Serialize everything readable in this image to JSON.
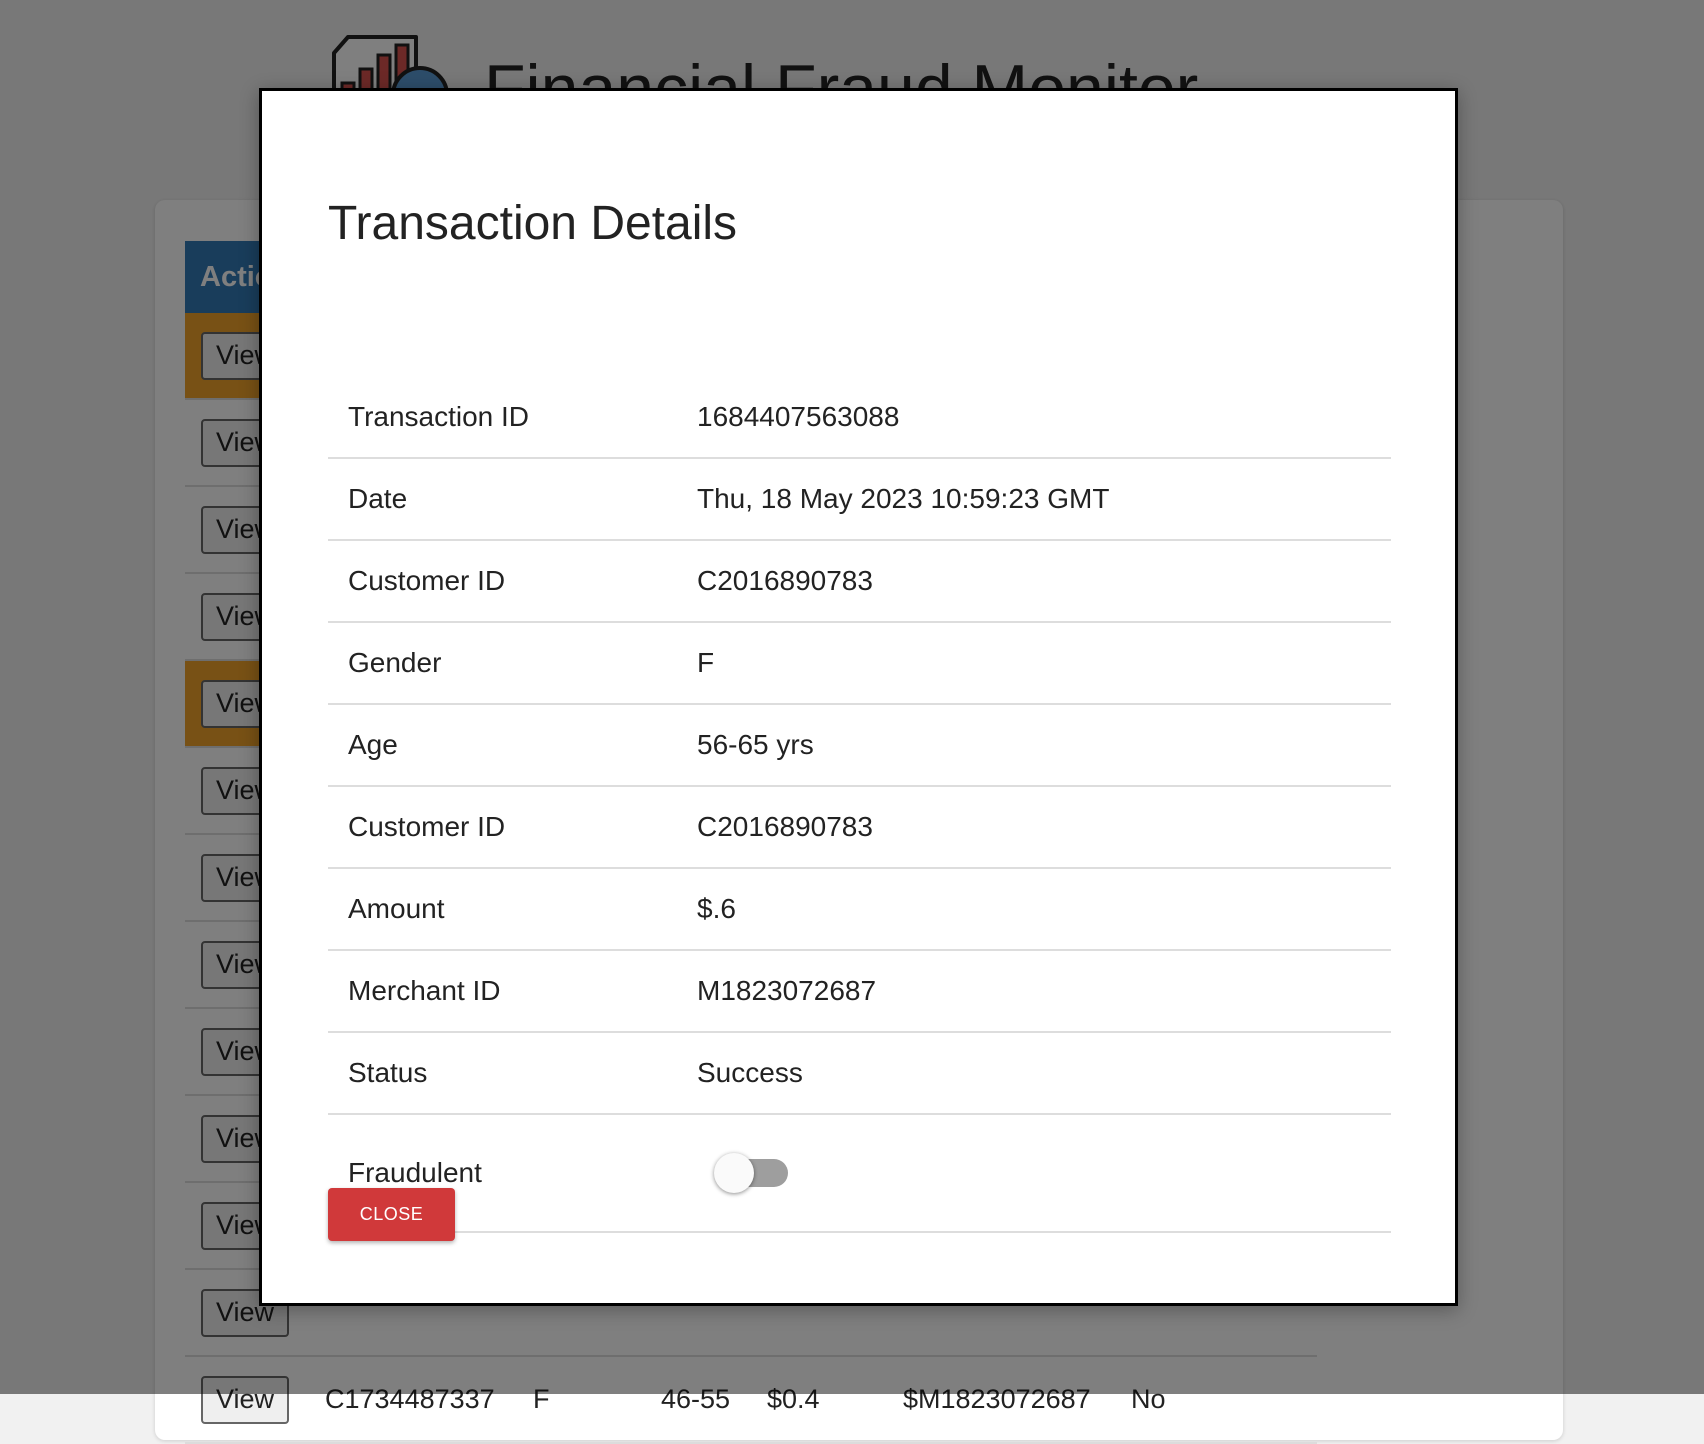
{
  "app": {
    "title": "Financial Fraud Monitor",
    "logo_icon": "chart-analytics-icon"
  },
  "table": {
    "action_header": "Actions",
    "view_label": "View",
    "rows": [
      {
        "flagged": true
      },
      {
        "flagged": false
      },
      {
        "flagged": false
      },
      {
        "flagged": false
      },
      {
        "flagged": true
      },
      {
        "flagged": false
      },
      {
        "flagged": false
      },
      {
        "flagged": false
      },
      {
        "flagged": false
      },
      {
        "flagged": false
      },
      {
        "flagged": false
      },
      {
        "flagged": false
      },
      {
        "flagged": false,
        "customer_id": "C1734487337",
        "gender": "F",
        "age": "46-55",
        "amount": "$0.4",
        "merchant": "$M1823072687",
        "fraud": "No"
      }
    ]
  },
  "modal": {
    "title": "Transaction Details",
    "fields": [
      {
        "label": "Transaction ID",
        "value": "1684407563088"
      },
      {
        "label": "Date",
        "value": "Thu, 18 May 2023 10:59:23 GMT"
      },
      {
        "label": "Customer ID",
        "value": "C2016890783"
      },
      {
        "label": "Gender",
        "value": "F"
      },
      {
        "label": "Age",
        "value": "56-65 yrs"
      },
      {
        "label": "Customer ID",
        "value": "C2016890783"
      },
      {
        "label": "Amount",
        "value": "$.6"
      },
      {
        "label": "Merchant ID",
        "value": "M1823072687"
      },
      {
        "label": "Status",
        "value": "Success"
      }
    ],
    "fraudulent": {
      "label": "Fraudulent",
      "checked": false
    },
    "close_label": "CLOSE"
  },
  "colors": {
    "table_header": "#337ab7",
    "flagged_row": "#f0a32a",
    "close_button": "#d0393a",
    "toggle_track": "#9e9e9e"
  }
}
